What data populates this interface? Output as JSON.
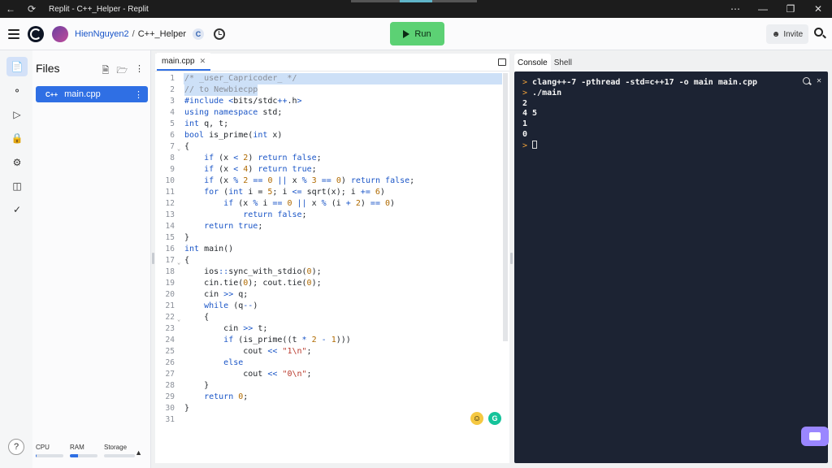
{
  "window": {
    "title": "Replit - C++_Helper - Replit",
    "controls": [
      "minimize-icon",
      "maximize-icon",
      "close-icon"
    ]
  },
  "header": {
    "username": "HienNguyen2",
    "separator": "/",
    "repl_name": "C++_Helper",
    "lang_badge": "C",
    "run_label": "Run",
    "invite_label": "Invite"
  },
  "files": {
    "title": "Files",
    "items": [
      {
        "icon": "C++",
        "name": "main.cpp"
      }
    ]
  },
  "resources": {
    "cpu_label": "CPU",
    "ram_label": "RAM",
    "storage_label": "Storage",
    "cpu_level": 0.03,
    "ram_level": 0.3,
    "storage_level": 0
  },
  "editor": {
    "tab_label": "main.cpp",
    "lines": [
      "/* _user_Capricoder_ */",
      "// to Newbiecpp",
      "#include <bits/stdc++.h>",
      "using namespace std;",
      "int q, t;",
      "bool is_prime(int x)",
      "{",
      "    if (x < 2) return false;",
      "    if (x < 4) return true;",
      "    if (x % 2 == 0 || x % 3 == 0) return false;",
      "    for (int i = 5; i <= sqrt(x); i += 6)",
      "        if (x % i == 0 || x % (i + 2) == 0)",
      "            return false;",
      "    return true;",
      "}",
      "int main()",
      "{",
      "    ios::sync_with_stdio(0);",
      "    cin.tie(0); cout.tie(0);",
      "    cin >> q;",
      "    while (q--)",
      "    {",
      "        cin >> t;",
      "        if (is_prime((t * 2 - 1)))",
      "            cout << \"1\\n\";",
      "        else",
      "            cout << \"0\\n\";",
      "    }",
      "    return 0;",
      "}",
      ""
    ]
  },
  "right_panel": {
    "tabs": [
      "Console",
      "Shell"
    ],
    "console_lines": [
      {
        "prompt": ">",
        "text": "clang++-7 -pthread -std=c++17 -o main main.cpp",
        "bold": true
      },
      {
        "prompt": ">",
        "text": "./main",
        "bold": true
      },
      {
        "prompt": "",
        "text": "2",
        "bold": true
      },
      {
        "prompt": "",
        "text": "4 5",
        "bold": true
      },
      {
        "prompt": "",
        "text": "1",
        "bold": true
      },
      {
        "prompt": "",
        "text": "0",
        "bold": true
      }
    ],
    "final_prompt": ">"
  }
}
